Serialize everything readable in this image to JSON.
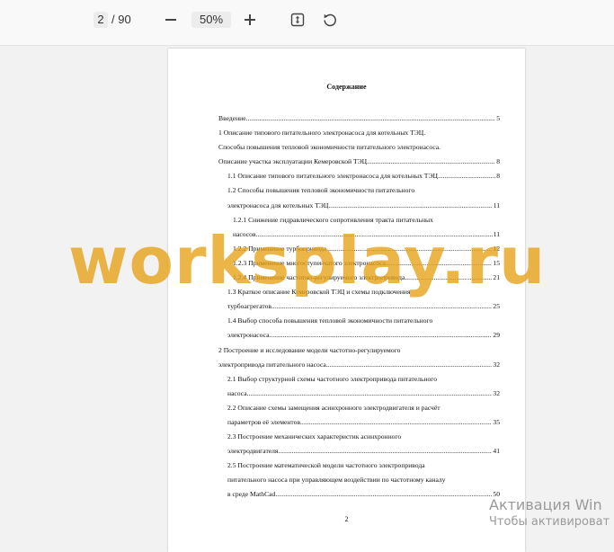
{
  "toolbar": {
    "current_page": "2",
    "total_pages": "/ 90",
    "zoom_level": "50%",
    "icons": [
      "minus-icon",
      "plus-icon",
      "fit-page-icon",
      "rotate-icon"
    ]
  },
  "document": {
    "toc_title": "Содержание",
    "toc_lines": [
      {
        "text": "Введение",
        "dots": true,
        "page": "5",
        "indent": 0
      },
      {
        "text": "1 Описание типового питательного электронасоса для котельных ТЭЦ.",
        "dots": false,
        "page": "",
        "indent": 0
      },
      {
        "text": "Способы повышения тепловой экономичности питательного электронасоса.",
        "dots": false,
        "page": "",
        "indent": 0
      },
      {
        "text": "Описание участка эксплуатации Кемеровской ТЭЦ",
        "dots": true,
        "page": "8",
        "indent": 0
      },
      {
        "text": "1.1 Описание типового питательного электронасоса для котельных ТЭЦ",
        "dots": true,
        "page": "8",
        "indent": 1
      },
      {
        "text": "1.2 Способы повышения тепловой экономичности питательного",
        "dots": false,
        "page": "",
        "indent": 1
      },
      {
        "text": "электронасоса для котельных ТЭЦ",
        "dots": true,
        "page": "11",
        "indent": 1
      },
      {
        "text": "1.2.1 Снижение гидравлического сопротивления тракта питательных",
        "dots": false,
        "page": "",
        "indent": 2
      },
      {
        "text": "насосов",
        "dots": true,
        "page": "11",
        "indent": 2
      },
      {
        "text": "1.2.2 Применение турбопривода",
        "dots": true,
        "page": "12",
        "indent": 2
      },
      {
        "text": "1.2.3 Применение многоступенчатого электронасоса",
        "dots": true,
        "page": "15",
        "indent": 2
      },
      {
        "text": "1.2.4 Применение частотно-регулируемого электропривода",
        "dots": true,
        "page": "21",
        "indent": 2
      },
      {
        "text": "1.3 Краткое описание Кемеровской ТЭЦ и схемы подключения",
        "dots": false,
        "page": "",
        "indent": 1
      },
      {
        "text": "турбоагрегатов",
        "dots": true,
        "page": "25",
        "indent": 1
      },
      {
        "text": "1.4 Выбор способа повышения тепловой экономичности питательного",
        "dots": false,
        "page": "",
        "indent": 1
      },
      {
        "text": "электронасоса",
        "dots": true,
        "page": "29",
        "indent": 1
      },
      {
        "text": "2 Построение и исследование модели частотно-регулируемого",
        "dots": false,
        "page": "",
        "indent": 0
      },
      {
        "text": "электропривода питательного насоса",
        "dots": true,
        "page": "32",
        "indent": 0
      },
      {
        "text": "2.1 Выбор структурной схемы частотного электропривода питательного",
        "dots": false,
        "page": "",
        "indent": 1
      },
      {
        "text": "насоса",
        "dots": true,
        "page": "32",
        "indent": 1
      },
      {
        "text": "2.2 Описание схемы замещения асинхронного электродвигателя и расчёт",
        "dots": false,
        "page": "",
        "indent": 1
      },
      {
        "text": "параметров её элементов",
        "dots": true,
        "page": "35",
        "indent": 1
      },
      {
        "text": "2.3 Построение механических характеристик асинхронного",
        "dots": false,
        "page": "",
        "indent": 1
      },
      {
        "text": "электродвигателя",
        "dots": true,
        "page": "41",
        "indent": 1
      },
      {
        "text": "2.5 Построение математической модели частотного электропривода",
        "dots": false,
        "page": "",
        "indent": 1
      },
      {
        "text": "питательного насоса при управляющем воздействии по частотному каналу",
        "dots": false,
        "page": "",
        "indent": 1
      },
      {
        "text": "в среде MathCad",
        "dots": true,
        "page": "50",
        "indent": 1
      }
    ],
    "page_number": "2"
  },
  "watermark": "worksplay.ru",
  "activation": {
    "line1": "Активация Win",
    "line2": "Чтобы активироват"
  }
}
